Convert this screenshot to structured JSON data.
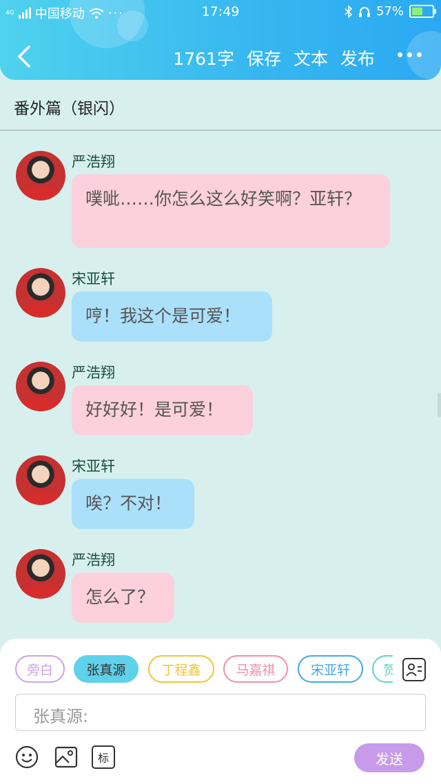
{
  "status": {
    "carrier": "中国移动",
    "signal_label": "4G",
    "time": "17:49",
    "battery": "57%",
    "battery_level": 0.57
  },
  "nav": {
    "back_icon": "chevron-left-icon",
    "word_count": "1761字",
    "save": "保存",
    "text": "文本",
    "publish": "发布"
  },
  "title": "番外篇（银闪）",
  "messages": [
    {
      "name": "严浩翔",
      "text": "噗呲……你怎么这么好笑啊？亚轩？",
      "color": "pink"
    },
    {
      "name": "宋亚轩",
      "text": "哼！我这个是可爱！",
      "color": "blue"
    },
    {
      "name": "严浩翔",
      "text": "好好好！是可爱！",
      "color": "pink"
    },
    {
      "name": "宋亚轩",
      "text": "唉？不对！",
      "color": "blue"
    },
    {
      "name": "严浩翔",
      "text": "怎么了？",
      "color": "pink"
    }
  ],
  "chips": [
    {
      "label": "旁白",
      "color": "#c9a3e6",
      "selected": false
    },
    {
      "label": "张真源",
      "color": "#5fd1ea",
      "selected": true
    },
    {
      "label": "丁程鑫",
      "color": "#f0c43b",
      "selected": false
    },
    {
      "label": "马嘉祺",
      "color": "#ef8fa8",
      "selected": false
    },
    {
      "label": "宋亚轩",
      "color": "#41a8ea",
      "selected": false
    },
    {
      "label": "贺",
      "color": "#5fd1c8",
      "selected": false
    }
  ],
  "input": {
    "placeholder": "张真源:"
  },
  "tools": {
    "emoji_icon": "smiley-icon",
    "image_icon": "image-icon",
    "tag_label": "标"
  },
  "send_label": "发送"
}
